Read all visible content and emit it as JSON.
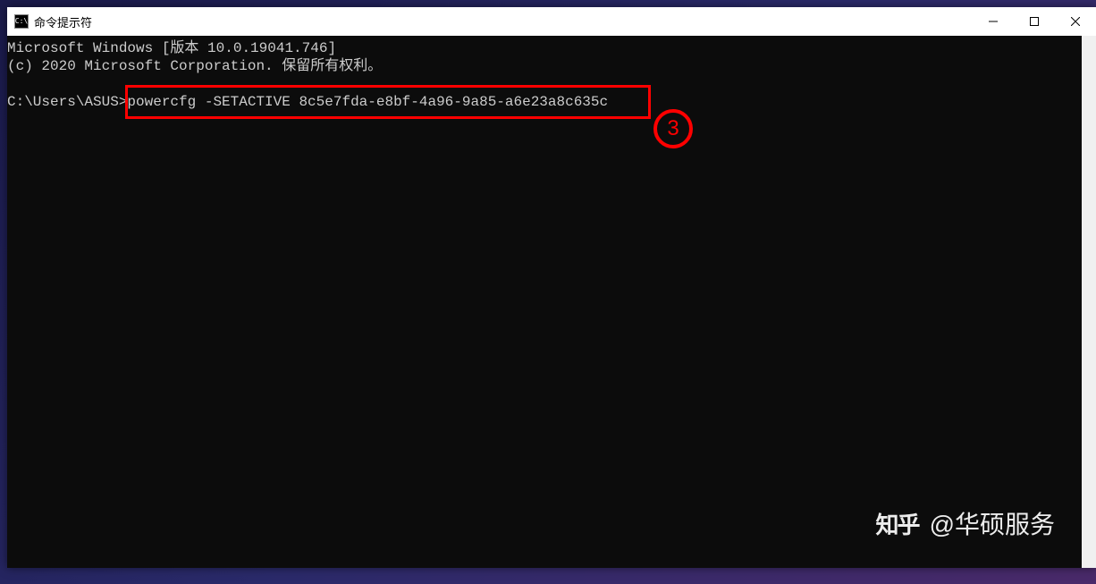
{
  "window": {
    "title": "命令提示符"
  },
  "console": {
    "line1": "Microsoft Windows [版本 10.0.19041.746]",
    "line2": "(c) 2020 Microsoft Corporation. 保留所有权利。",
    "prompt": "C:\\Users\\ASUS>",
    "command": "powercfg -SETACTIVE 8c5e7fda-e8bf-4a96-9a85-a6e23a8c635c"
  },
  "annotation": {
    "number": "3"
  },
  "watermark": {
    "logo": "知乎",
    "text": "@华硕服务"
  }
}
